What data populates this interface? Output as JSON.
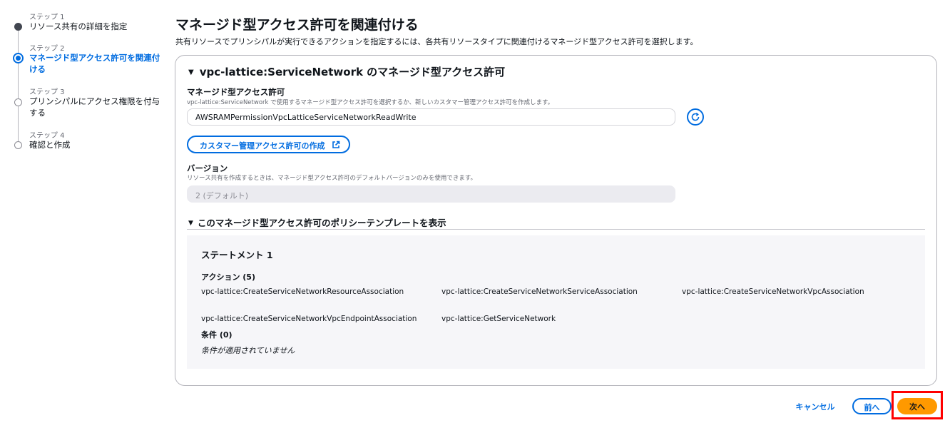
{
  "steps": [
    {
      "num": "ステップ 1",
      "label": "リソース共有の詳細を指定",
      "state": "done"
    },
    {
      "num": "ステップ 2",
      "label": "マネージド型アクセス許可を関連付ける",
      "state": "current"
    },
    {
      "num": "ステップ 3",
      "label": "プリンシパルにアクセス権限を付与する",
      "state": "pending"
    },
    {
      "num": "ステップ 4",
      "label": "確認と作成",
      "state": "pending"
    }
  ],
  "header": {
    "title": "マネージド型アクセス許可を関連付ける",
    "description": "共有リソースでプリンシパルが実行できるアクションを指定するには、各共有リソースタイプに関連付けるマネージド型アクセス許可を選択します。"
  },
  "section": {
    "title": "vpc-lattice:ServiceNetwork のマネージド型アクセス許可",
    "permission_label": "マネージド型アクセス許可",
    "permission_desc": "vpc-lattice:ServiceNetwork で使用するマネージド型アクセス許可を選択するか、新しいカスタマー管理アクセス許可を作成します。",
    "permission_value": "AWSRAMPermissionVpcLatticeServiceNetworkReadWrite",
    "create_button": "カスタマー管理アクセス許可の作成",
    "version_label": "バージョン",
    "version_desc": "リソース共有を作成するときは、マネージド型アクセス許可のデフォルトバージョンのみを使用できます。",
    "version_value": "2 (デフォルト)"
  },
  "policy": {
    "expander_title": "このマネージド型アクセス許可のポリシーテンプレートを表示",
    "statement_title": "ステートメント 1",
    "actions_heading": "アクション (5)",
    "actions": [
      "vpc-lattice:CreateServiceNetworkResourceAssociation",
      "vpc-lattice:CreateServiceNetworkServiceAssociation",
      "vpc-lattice:CreateServiceNetworkVpcAssociation",
      "vpc-lattice:CreateServiceNetworkVpcEndpointAssociation",
      "vpc-lattice:GetServiceNetwork"
    ],
    "conditions_heading": "条件 (0)",
    "conditions_empty": "条件が適用されていません"
  },
  "footer": {
    "cancel": "キャンセル",
    "previous": "前へ",
    "next": "次へ"
  },
  "colors": {
    "accent": "#006ce0",
    "primary_button": "#ff9900",
    "highlight": "#ff0000"
  }
}
